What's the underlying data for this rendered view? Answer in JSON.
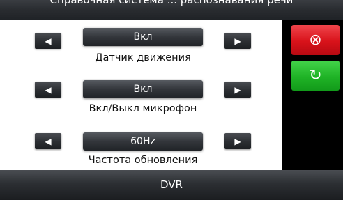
{
  "header": {
    "title": "Справочная система ... распознавания речи"
  },
  "settings": [
    {
      "value": "Вкл",
      "label": "Датчик движения",
      "prev_icon": "◀",
      "next_icon": "▶"
    },
    {
      "value": "Вкл",
      "label": "Вкл/Выкл микрофон",
      "prev_icon": "◀",
      "next_icon": "▶"
    },
    {
      "value": "60Hz",
      "label": "Частота обновления",
      "prev_icon": "◀",
      "next_icon": "▶"
    }
  ],
  "actions": {
    "cancel_icon": "⊗",
    "refresh_icon": "↻",
    "cancel_color": "#e0141c",
    "refresh_color": "#22b82a"
  },
  "footer": {
    "title": "DVR"
  }
}
